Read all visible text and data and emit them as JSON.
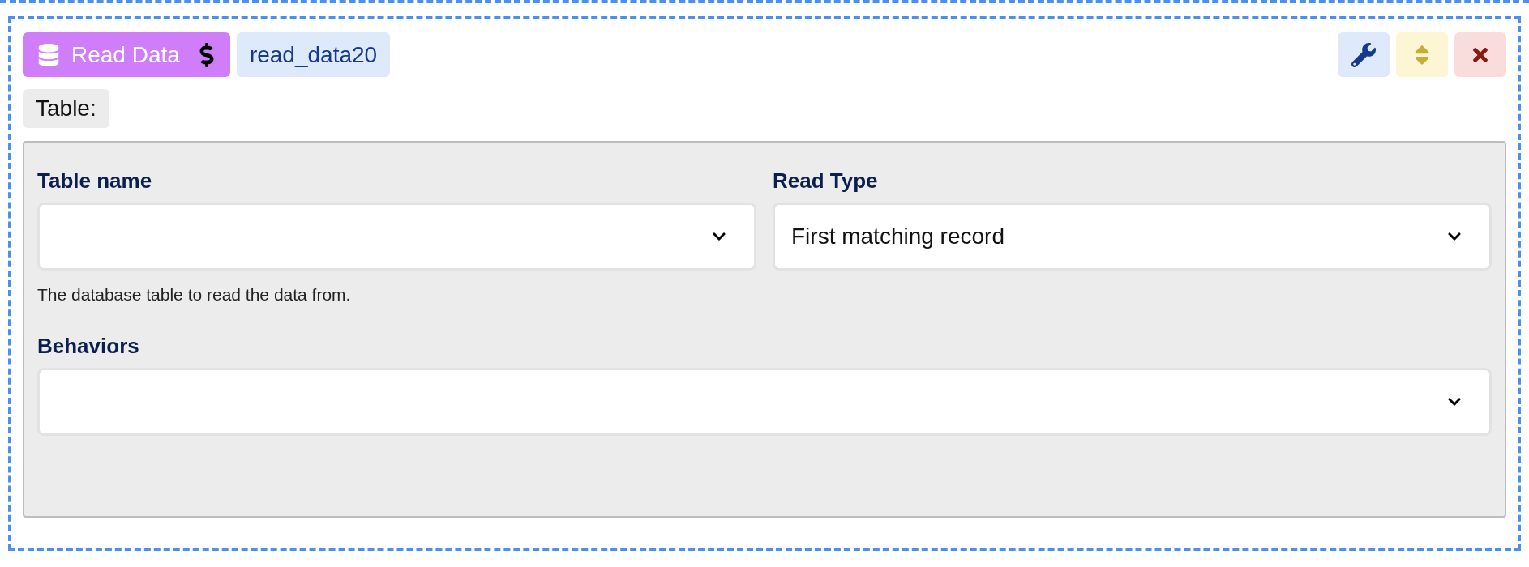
{
  "block": {
    "type_label": "Read Data",
    "name": "read_data20",
    "section_label": "Table:"
  },
  "fields": [
    {
      "label": "Table name",
      "help": "The database table to read the data from.",
      "kind": "half"
    },
    {
      "label": "Read Type",
      "value": "First matching record",
      "kind": "half"
    },
    {
      "label": "Behaviors",
      "kind": "full"
    }
  ]
}
